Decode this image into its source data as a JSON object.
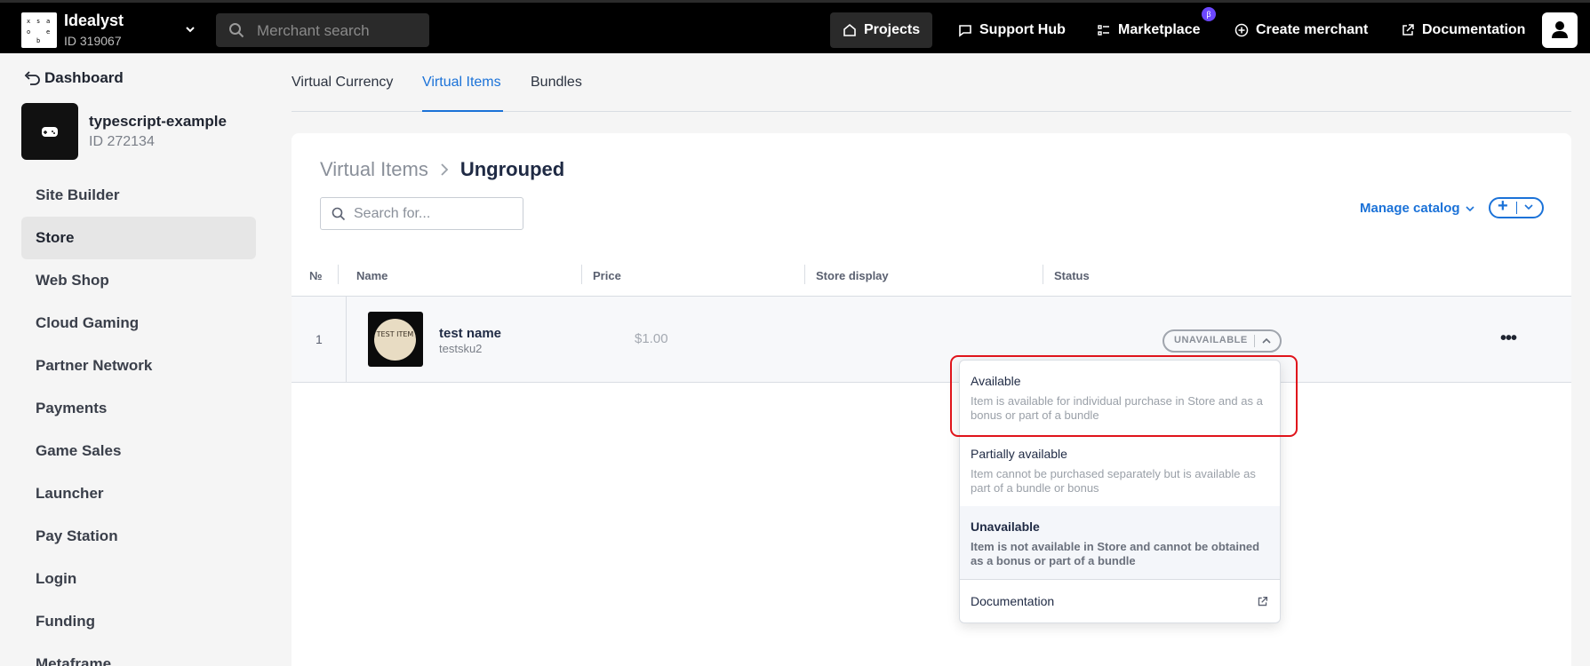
{
  "topbar": {
    "brand_name": "Idealyst",
    "brand_id": "ID 319067",
    "logo_glyphs": [
      "x",
      "s",
      "a",
      "o",
      "e",
      "b"
    ],
    "search_placeholder": "Merchant search",
    "nav": [
      {
        "label": "Projects",
        "icon": "home-icon",
        "active": true
      },
      {
        "label": "Support Hub",
        "icon": "chat-icon"
      },
      {
        "label": "Marketplace",
        "icon": "list-icon",
        "badge": "β"
      },
      {
        "label": "Create merchant",
        "icon": "plus-circle-icon"
      },
      {
        "label": "Documentation",
        "icon": "external-link-icon"
      }
    ]
  },
  "sidebar": {
    "dashboard_label": "Dashboard",
    "project_name": "typescript-example",
    "project_id": "ID 272134",
    "items": [
      {
        "label": "Site Builder"
      },
      {
        "label": "Store",
        "active": true
      },
      {
        "label": "Web Shop"
      },
      {
        "label": "Cloud Gaming"
      },
      {
        "label": "Partner Network"
      },
      {
        "label": "Payments"
      },
      {
        "label": "Game Sales"
      },
      {
        "label": "Launcher"
      },
      {
        "label": "Pay Station"
      },
      {
        "label": "Login"
      },
      {
        "label": "Funding"
      },
      {
        "label": "Metaframe"
      }
    ]
  },
  "tabs": [
    {
      "label": "Virtual Currency"
    },
    {
      "label": "Virtual Items",
      "active": true
    },
    {
      "label": "Bundles"
    }
  ],
  "content": {
    "breadcrumb_parent": "Virtual Items",
    "breadcrumb_current": "Ungrouped",
    "search_placeholder": "Search for...",
    "manage_catalog": "Manage catalog",
    "add_symbol": "+",
    "columns": [
      "№",
      "Name",
      "Price",
      "Store display",
      "Status"
    ],
    "rows": [
      {
        "no": "1",
        "thumb_text": "TEST ITEM",
        "name": "test name",
        "sku": "testsku2",
        "price": "$1.00",
        "status": "UNAVAILABLE",
        "more": "•••"
      }
    ]
  },
  "status_dropdown": {
    "options": [
      {
        "title": "Available",
        "desc": "Item is available for individual purchase in Store and as a bonus or part of a bundle"
      },
      {
        "title": "Partially available",
        "desc": "Item cannot be purchased separately but is available as part of a bundle or bonus"
      },
      {
        "title": "Unavailable",
        "desc": "Item is not available in Store and cannot be obtained as a bonus or part of a bundle",
        "selected": true
      }
    ],
    "documentation_label": "Documentation",
    "highlighted_option": "Available"
  },
  "colors": {
    "accent": "#1b72d8",
    "highlight": "#e0141b",
    "beta_badge": "#6c47ff"
  }
}
